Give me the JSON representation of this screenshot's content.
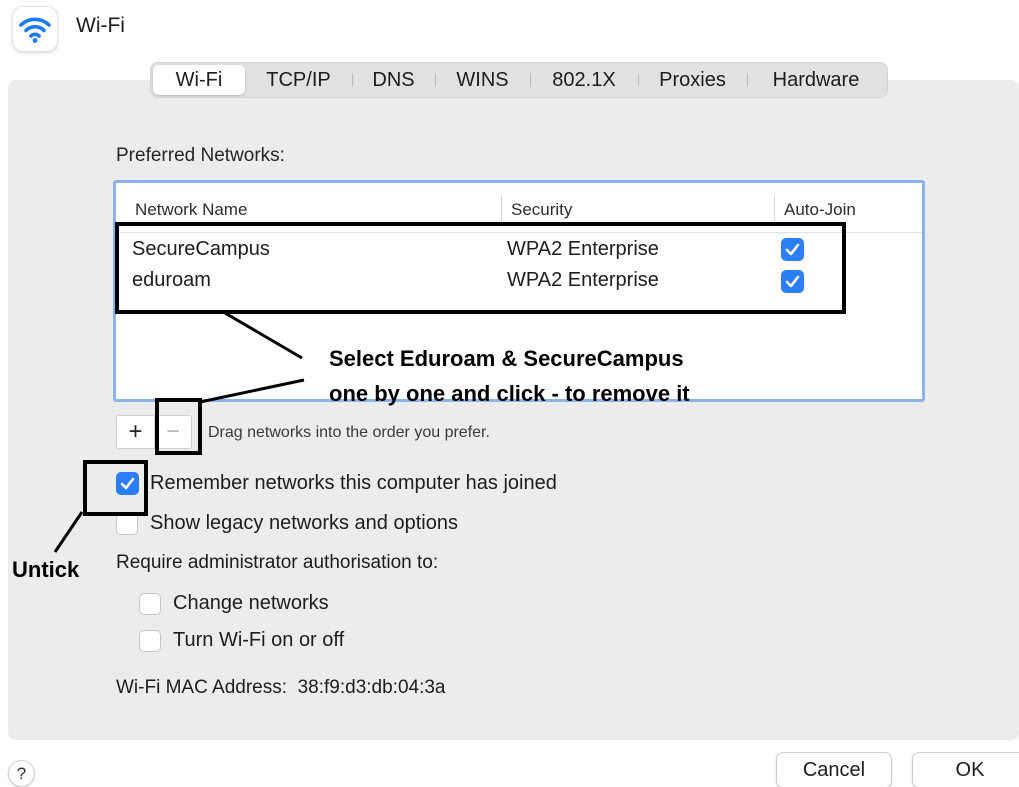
{
  "window": {
    "title": "Wi-Fi",
    "icon": "wifi-icon"
  },
  "tabs": [
    {
      "label": "Wi-Fi",
      "active": true
    },
    {
      "label": "TCP/IP",
      "active": false
    },
    {
      "label": "DNS",
      "active": false
    },
    {
      "label": "WINS",
      "active": false
    },
    {
      "label": "802.1X",
      "active": false
    },
    {
      "label": "Proxies",
      "active": false
    },
    {
      "label": "Hardware",
      "active": false
    }
  ],
  "preferred": {
    "label": "Preferred Networks:",
    "columns": {
      "name": "Network Name",
      "security": "Security",
      "autojoin": "Auto-Join"
    },
    "rows": [
      {
        "name": "SecureCampus",
        "security": "WPA2 Enterprise",
        "auto_join": true
      },
      {
        "name": "eduroam",
        "security": "WPA2 Enterprise",
        "auto_join": true
      }
    ],
    "add_label": "+",
    "remove_label": "−",
    "hint": "Drag networks into the order you prefer."
  },
  "options": {
    "remember": {
      "label": "Remember networks this computer has joined",
      "checked": true
    },
    "legacy": {
      "label": "Show legacy networks and options",
      "checked": false
    },
    "require_label": "Require administrator authorisation to:",
    "change_networks": {
      "label": "Change networks",
      "checked": false
    },
    "toggle_wifi": {
      "label": "Turn Wi-Fi on or off",
      "checked": false
    }
  },
  "mac": {
    "label": "Wi-Fi MAC Address:",
    "value": "38:f9:d3:db:04:3a"
  },
  "footer": {
    "help": "?",
    "cancel": "Cancel",
    "ok": "OK"
  },
  "annotations": {
    "instruction_line1": "Select Eduroam & SecureCampus",
    "instruction_line2": "one by one and click - to remove it",
    "untick": "Untick"
  },
  "colors": {
    "accent": "#2b7ef5",
    "list_focus": "#8db2e8",
    "annotation": "#000000"
  }
}
